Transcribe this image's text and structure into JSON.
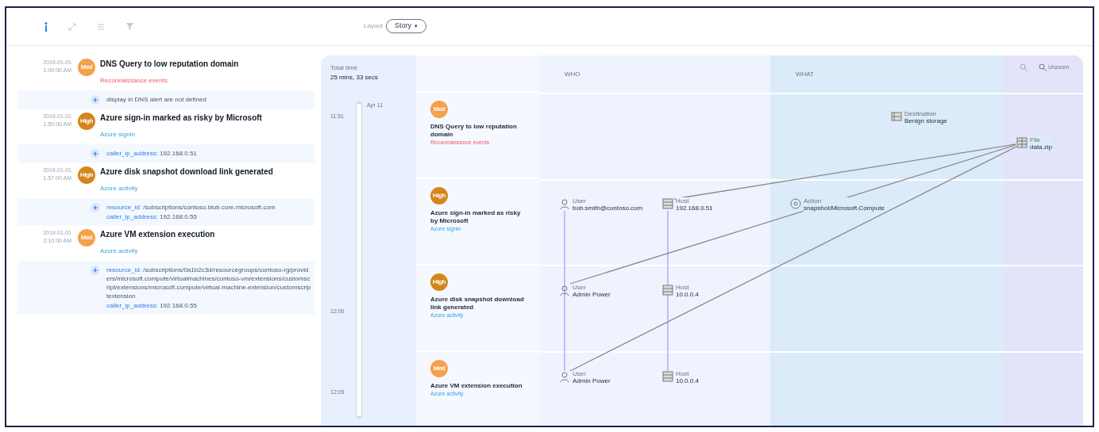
{
  "toolbar": {
    "tools": [
      {
        "kind": "info",
        "selected": true
      },
      {
        "kind": "expand",
        "selected": false
      },
      {
        "kind": "list",
        "selected": false
      },
      {
        "kind": "filter",
        "selected": false
      }
    ],
    "group_by": {
      "label": "Layout",
      "value": "Story",
      "caret": "▾"
    }
  },
  "events": [
    {
      "date": "2019-01-01",
      "time": "1:00:00 AM",
      "badge": "Med",
      "color": "#f5a04a",
      "title": "DNS Query to low reputation domain",
      "source": "Reconnaissance events",
      "kind": "alert",
      "details": [
        {
          "kind": "text",
          "text": "display in DNS alert are not defined"
        }
      ]
    },
    {
      "date": "2019-01-01",
      "time": "1:50:00 AM",
      "badge": "High",
      "color": "#d4861c",
      "title": "Azure sign-in marked as risky by Microsoft",
      "source": "Azure signin",
      "kind": "activity",
      "details": [
        {
          "kind": "pair",
          "key": "caller_ip_address:",
          "text": "192.168.0.51"
        }
      ]
    },
    {
      "date": "2019-01-01",
      "time": "1:57:00 AM",
      "badge": "High",
      "color": "#d4861c",
      "title": "Azure disk snapshot download link generated",
      "source": "Azure activity",
      "kind": "activity",
      "details": [
        {
          "kind": "pair",
          "key": "resource_id:",
          "text": "/subscriptions/contoso.blob.core.microsoft.com"
        },
        {
          "kind": "pair",
          "key": "caller_ip_address:",
          "text": "192.168.0.55"
        }
      ]
    },
    {
      "date": "2019-01-01",
      "time": "2:10:00 AM",
      "badge": "Med",
      "color": "#f5a04a",
      "title": "Azure VM extension execution",
      "source": "Azure activity",
      "kind": "activity",
      "details": [
        {
          "kind": "pair",
          "key": "resource_id:",
          "text": "/subscriptions/0a1b2c3d/resourcegroups/contoso-rg/providers/microsoft.compute/virtualmachines/contoso-vm/extensions/customscript/extensions/microsoft.compute/virtual-machine-extension/customscriptextension"
        },
        {
          "kind": "pair",
          "key": "caller_ip_address:",
          "text": "192.168.0.55"
        }
      ]
    }
  ],
  "story": {
    "slider": {
      "level": 1
    },
    "total_time_label": "Total time",
    "total_time": "25 mins, 33 secs",
    "axis_start": "Apr 11",
    "ticks": [
      "11:51",
      "12:00",
      "12:05"
    ],
    "cards": [
      {
        "badge": "Med",
        "color": "#f5a04a",
        "title": "DNS Query to low reputation domain",
        "source": "Reconnaissance events",
        "kind": "alert"
      },
      {
        "badge": "High",
        "color": "#d4861c",
        "title": "Azure sign-in marked as risky by Microsoft",
        "source": "Azure signin",
        "kind": "activity"
      },
      {
        "badge": "High",
        "color": "#d4861c",
        "title": "Azure disk snapshot download link generated",
        "source": "Azure activity",
        "kind": "activity"
      },
      {
        "badge": "Med",
        "color": "#f5a04a",
        "title": "Azure VM extension execution",
        "source": "Azure activity",
        "kind": "activity"
      }
    ]
  },
  "graph": {
    "columns": [
      "WHO",
      "WHAT"
    ],
    "reset_label": "Unzoom",
    "nodes": [
      {
        "kind": "storage",
        "label": "Destination",
        "value": "Benign storage"
      },
      {
        "kind": "file",
        "label": "File",
        "value": "data.zip"
      },
      {
        "kind": "user",
        "label": "User",
        "value": "bob.smith@contoso.com"
      },
      {
        "kind": "host",
        "label": "Host",
        "value": "192.168.0.51"
      },
      {
        "kind": "action",
        "label": "Action",
        "value": "snapshot/Microsoft.Compute"
      },
      {
        "kind": "user",
        "label": "User",
        "value": "Admin Power"
      },
      {
        "kind": "host",
        "label": "Host",
        "value": "10.0.0.4"
      },
      {
        "kind": "user",
        "label": "User",
        "value": "Admin Power"
      },
      {
        "kind": "host",
        "label": "Host",
        "value": "10.0.0.4"
      }
    ]
  }
}
